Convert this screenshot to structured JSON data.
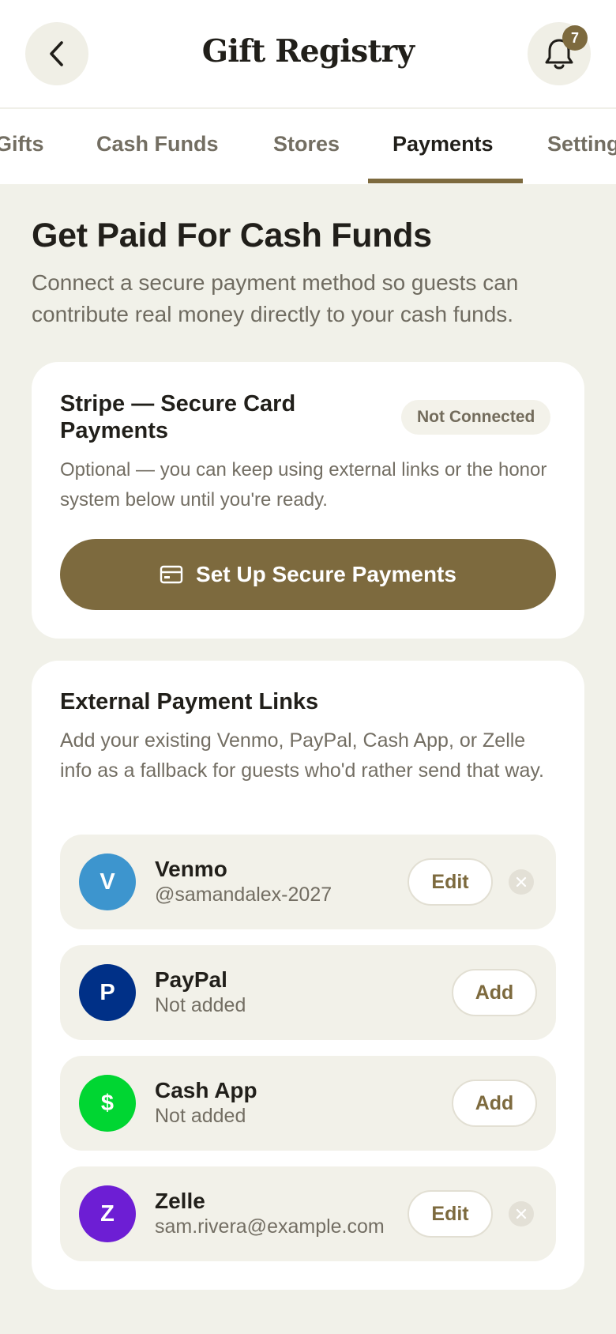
{
  "header": {
    "title": "Gift Registry",
    "back_icon": "chevron-left-icon",
    "bell_icon": "bell-icon",
    "notification_count": "7"
  },
  "tabs": [
    {
      "label": "Gifts",
      "active": false
    },
    {
      "label": "Cash Funds",
      "active": false
    },
    {
      "label": "Stores",
      "active": false
    },
    {
      "label": "Payments",
      "active": true
    },
    {
      "label": "Settings",
      "active": false
    }
  ],
  "hero": {
    "title": "Get Paid For Cash Funds",
    "description": "Connect a secure payment method so guests can contribute real money directly to your cash funds."
  },
  "stripe": {
    "title": "Stripe — Secure Card Payments",
    "status": "Not Connected",
    "description": "Optional — you can keep using external links or the honor system below until you're ready.",
    "button_label": "Set Up Secure Payments",
    "button_icon": "credit-card-icon"
  },
  "external_links": {
    "title": "External Payment Links",
    "description": "Add your existing Venmo, PayPal, Cash App, or Zelle info as a fallback for guests who'd rather send that way.",
    "methods": [
      {
        "initial": "V",
        "name": "Venmo",
        "detail": "@samandalex-2027",
        "action": "Edit",
        "removable": true,
        "color": "#3d95ce"
      },
      {
        "initial": "P",
        "name": "PayPal",
        "detail": "Not added",
        "action": "Add",
        "removable": false,
        "color": "#003087"
      },
      {
        "initial": "$",
        "name": "Cash App",
        "detail": "Not added",
        "action": "Add",
        "removable": false,
        "color": "#00d632"
      },
      {
        "initial": "Z",
        "name": "Zelle",
        "detail": "sam.rivera@example.com",
        "action": "Edit",
        "removable": true,
        "color": "#6d1ed4"
      }
    ]
  },
  "colors": {
    "accent": "#7d6a3e",
    "background": "#f1f1e9",
    "card": "#ffffff"
  }
}
